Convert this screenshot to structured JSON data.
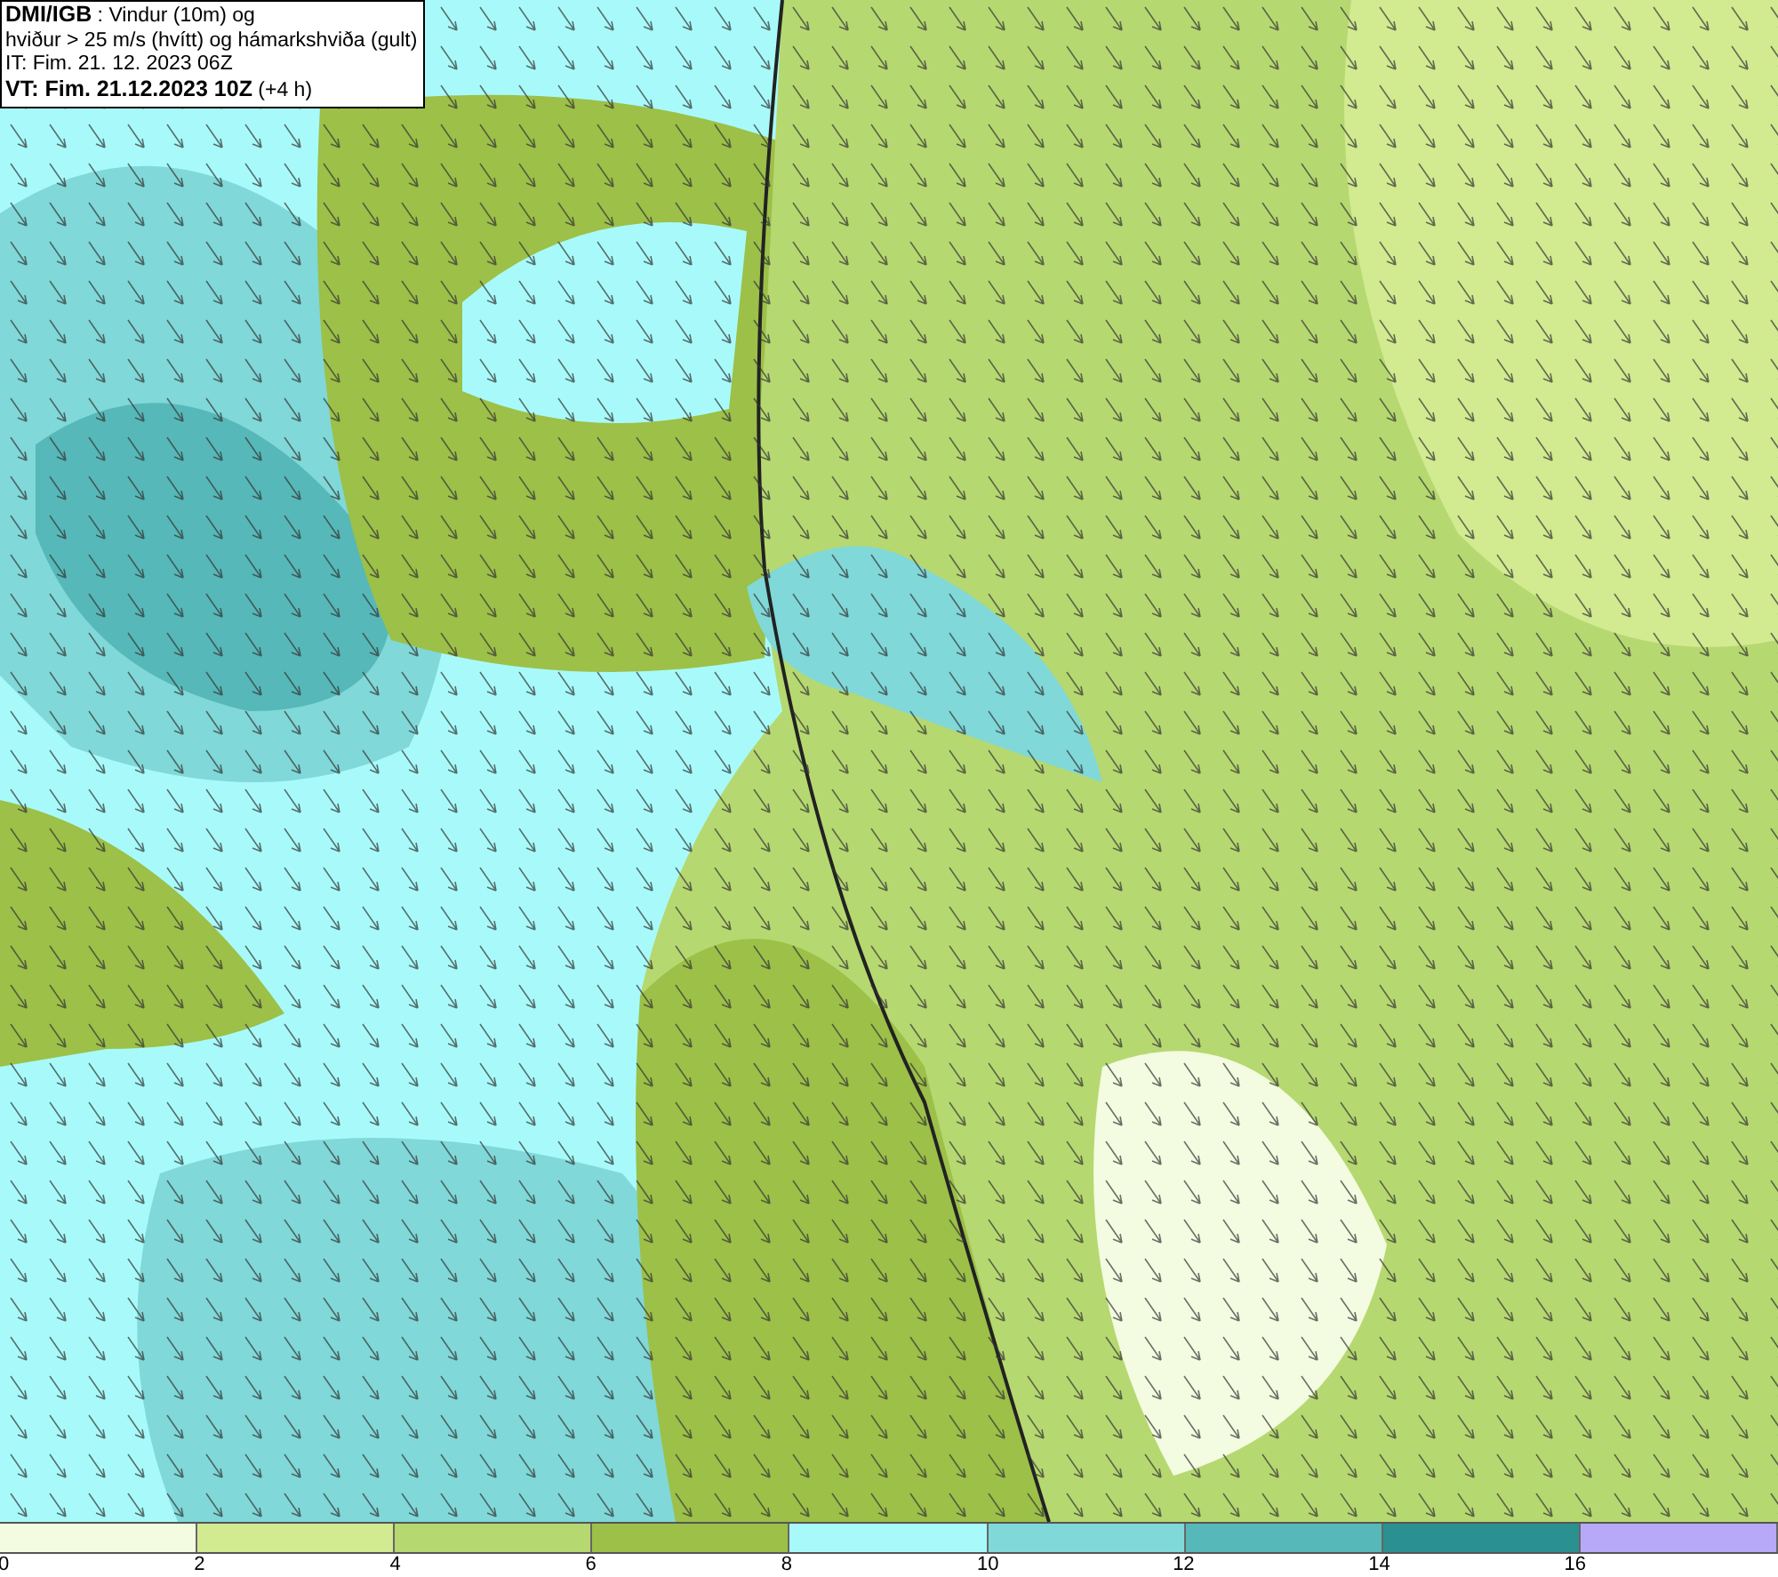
{
  "header": {
    "lines": [
      "**DMI/IGB** : Vindur (10m) og",
      "hviður > 25 m/s (hvítt) og hámarkshviða (gult)",
      "IT: Fim. 21. 12. 2023 06Z",
      "**VT: Fim. 21.12.2023 10Z** (+4 h)"
    ]
  },
  "legend": {
    "swatches": [
      {
        "color": "#f3fbe0"
      },
      {
        "color": "#d2ea90"
      },
      {
        "color": "#b6d870"
      },
      {
        "color": "#9cc048"
      },
      {
        "color": "#a8fafa"
      },
      {
        "color": "#80d8d8"
      },
      {
        "color": "#56b8b8"
      },
      {
        "color": "#2a9090"
      },
      {
        "color": "#b8a8f8"
      }
    ],
    "ticks": [
      "0",
      "2",
      "4",
      "6",
      "8",
      "10",
      "12",
      "14",
      "16"
    ]
  }
}
